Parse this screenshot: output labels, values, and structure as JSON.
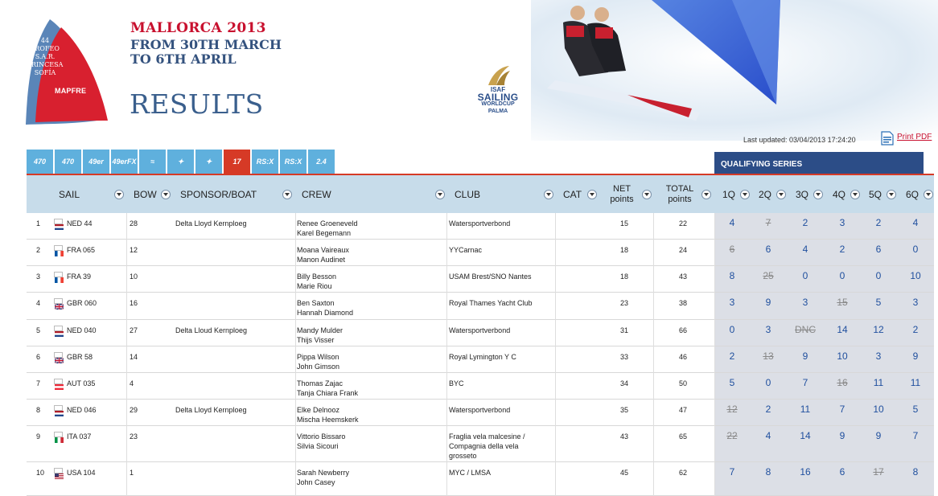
{
  "header": {
    "logo_text": [
      "44",
      "TROFEO",
      "S.A.R.",
      "PRINCESA",
      "SOFÍA"
    ],
    "logo_brand": "MAPFRE",
    "event_title": "MALLORCA 2013",
    "date_line1": "FROM 30TH MARCH",
    "date_line2": "TO 6TH APRIL",
    "page_title": "RESULTS",
    "isaf_line1": "ISAF",
    "isaf_line2": "SAILING",
    "isaf_line3": "WORLDCUP",
    "isaf_line4": "PALMA",
    "last_updated": "Last updated: 03/04/2013 17:24:20",
    "print_label": "Print PDF"
  },
  "tabs": [
    "470",
    "470",
    "49er",
    "49erFX",
    "≈",
    "✦",
    "✦",
    "17",
    "RS:X",
    "RS:X",
    "2.4"
  ],
  "active_tab": 7,
  "qualifying_series_label": "QUALIFYING SERIES",
  "columns": {
    "sail": "SAIL",
    "bow": "BOW",
    "sponsor": "SPONSOR/BOAT",
    "crew": "CREW",
    "club": "CLUB",
    "cat": "CAT",
    "net": "NET points",
    "total": "TOTAL points",
    "races": [
      "1Q",
      "2Q",
      "3Q",
      "4Q",
      "5Q",
      "6Q"
    ]
  },
  "colors": {
    "accent_red": "#d63a26",
    "tab_blue": "#5fb0dd",
    "navy": "#2c4d87",
    "race_blue": "#1f4f9e"
  },
  "rows": [
    {
      "rank": "1",
      "flag": "NED",
      "sail": "NED 44",
      "bow": "28",
      "sponsor": "Delta Lloyd Kernploeg",
      "crew1": "Renee Groeneveld",
      "crew2": "Karel Begemann",
      "club": "Watersportverbond",
      "club2": "",
      "club3": "",
      "net": "15",
      "total": "22",
      "races": [
        {
          "v": "4",
          "d": false
        },
        {
          "v": "7",
          "d": true
        },
        {
          "v": "2",
          "d": false
        },
        {
          "v": "3",
          "d": false
        },
        {
          "v": "2",
          "d": false
        },
        {
          "v": "4",
          "d": false
        }
      ]
    },
    {
      "rank": "2",
      "flag": "FRA",
      "sail": "FRA 065",
      "bow": "12",
      "sponsor": "",
      "crew1": "Moana Vaireaux",
      "crew2": "Manon Audinet",
      "club": "YYCarnac",
      "club2": "",
      "club3": "",
      "net": "18",
      "total": "24",
      "races": [
        {
          "v": "6",
          "d": true
        },
        {
          "v": "6",
          "d": false
        },
        {
          "v": "4",
          "d": false
        },
        {
          "v": "2",
          "d": false
        },
        {
          "v": "6",
          "d": false
        },
        {
          "v": "0",
          "d": false
        }
      ]
    },
    {
      "rank": "3",
      "flag": "FRA",
      "sail": "FRA 39",
      "bow": "10",
      "sponsor": "",
      "crew1": "Billy Besson",
      "crew2": "Marie Riou",
      "club": "USAM Brest/SNO Nantes",
      "club2": "",
      "club3": "",
      "net": "18",
      "total": "43",
      "races": [
        {
          "v": "8",
          "d": false
        },
        {
          "v": "25",
          "d": true
        },
        {
          "v": "0",
          "d": false
        },
        {
          "v": "0",
          "d": false
        },
        {
          "v": "0",
          "d": false
        },
        {
          "v": "10",
          "d": false
        }
      ]
    },
    {
      "rank": "4",
      "flag": "GBR",
      "sail": "GBR 060",
      "bow": "16",
      "sponsor": "",
      "crew1": "Ben Saxton",
      "crew2": "Hannah Diamond",
      "club": "Royal Thames Yacht Club",
      "club2": "",
      "club3": "",
      "net": "23",
      "total": "38",
      "races": [
        {
          "v": "3",
          "d": false
        },
        {
          "v": "9",
          "d": false
        },
        {
          "v": "3",
          "d": false
        },
        {
          "v": "15",
          "d": true
        },
        {
          "v": "5",
          "d": false
        },
        {
          "v": "3",
          "d": false
        }
      ]
    },
    {
      "rank": "5",
      "flag": "NED",
      "sail": "NED 040",
      "bow": "27",
      "sponsor": "Delta Lloud Kernploeg",
      "crew1": "Mandy Mulder",
      "crew2": "Thijs Visser",
      "club": "Watersportverbond",
      "club2": "",
      "club3": "",
      "net": "31",
      "total": "66",
      "races": [
        {
          "v": "0",
          "d": false
        },
        {
          "v": "3",
          "d": false
        },
        {
          "v": "DNC",
          "d": true
        },
        {
          "v": "14",
          "d": false
        },
        {
          "v": "12",
          "d": false
        },
        {
          "v": "2",
          "d": false
        }
      ]
    },
    {
      "rank": "6",
      "flag": "GBR",
      "sail": "GBR 58",
      "bow": "14",
      "sponsor": "",
      "crew1": "Pippa Wilson",
      "crew2": "John Gimson",
      "club": "Royal Lymington Y C",
      "club2": "",
      "club3": "",
      "net": "33",
      "total": "46",
      "races": [
        {
          "v": "2",
          "d": false
        },
        {
          "v": "13",
          "d": true
        },
        {
          "v": "9",
          "d": false
        },
        {
          "v": "10",
          "d": false
        },
        {
          "v": "3",
          "d": false
        },
        {
          "v": "9",
          "d": false
        }
      ]
    },
    {
      "rank": "7",
      "flag": "AUT",
      "sail": "AUT 035",
      "bow": "4",
      "sponsor": "",
      "crew1": "Thomas Zajac",
      "crew2": "Tanja Chiara Frank",
      "club": "BYC",
      "club2": "",
      "club3": "",
      "net": "34",
      "total": "50",
      "races": [
        {
          "v": "5",
          "d": false
        },
        {
          "v": "0",
          "d": false
        },
        {
          "v": "7",
          "d": false
        },
        {
          "v": "16",
          "d": true
        },
        {
          "v": "11",
          "d": false
        },
        {
          "v": "11",
          "d": false
        }
      ]
    },
    {
      "rank": "8",
      "flag": "NED",
      "sail": "NED 046",
      "bow": "29",
      "sponsor": "Delta Lloyd Kernploeg",
      "crew1": "Elke Delnooz",
      "crew2": "Mischa Heemskerk",
      "club": "Watersportverbond",
      "club2": "",
      "club3": "",
      "net": "35",
      "total": "47",
      "races": [
        {
          "v": "12",
          "d": true
        },
        {
          "v": "2",
          "d": false
        },
        {
          "v": "11",
          "d": false
        },
        {
          "v": "7",
          "d": false
        },
        {
          "v": "10",
          "d": false
        },
        {
          "v": "5",
          "d": false
        }
      ]
    },
    {
      "rank": "9",
      "flag": "ITA",
      "sail": "ITA 037",
      "bow": "23",
      "sponsor": "",
      "crew1": "Vittorio Bissaro",
      "crew2": "Silvia Sicouri",
      "club": "Fraglia vela malcesine /",
      "club2": "Compagnia della vela",
      "club3": "grosseto",
      "net": "43",
      "total": "65",
      "races": [
        {
          "v": "22",
          "d": true
        },
        {
          "v": "4",
          "d": false
        },
        {
          "v": "14",
          "d": false
        },
        {
          "v": "9",
          "d": false
        },
        {
          "v": "9",
          "d": false
        },
        {
          "v": "7",
          "d": false
        }
      ]
    },
    {
      "rank": "10",
      "flag": "USA",
      "sail": "USA 104",
      "bow": "1",
      "sponsor": "",
      "crew1": "Sarah Newberry",
      "crew2": "John Casey",
      "club": "MYC / LMSA",
      "club2": "",
      "club3": "",
      "net": "45",
      "total": "62",
      "races": [
        {
          "v": "7",
          "d": false
        },
        {
          "v": "8",
          "d": false
        },
        {
          "v": "16",
          "d": false
        },
        {
          "v": "6",
          "d": false
        },
        {
          "v": "17",
          "d": true
        },
        {
          "v": "8",
          "d": false
        }
      ]
    }
  ]
}
